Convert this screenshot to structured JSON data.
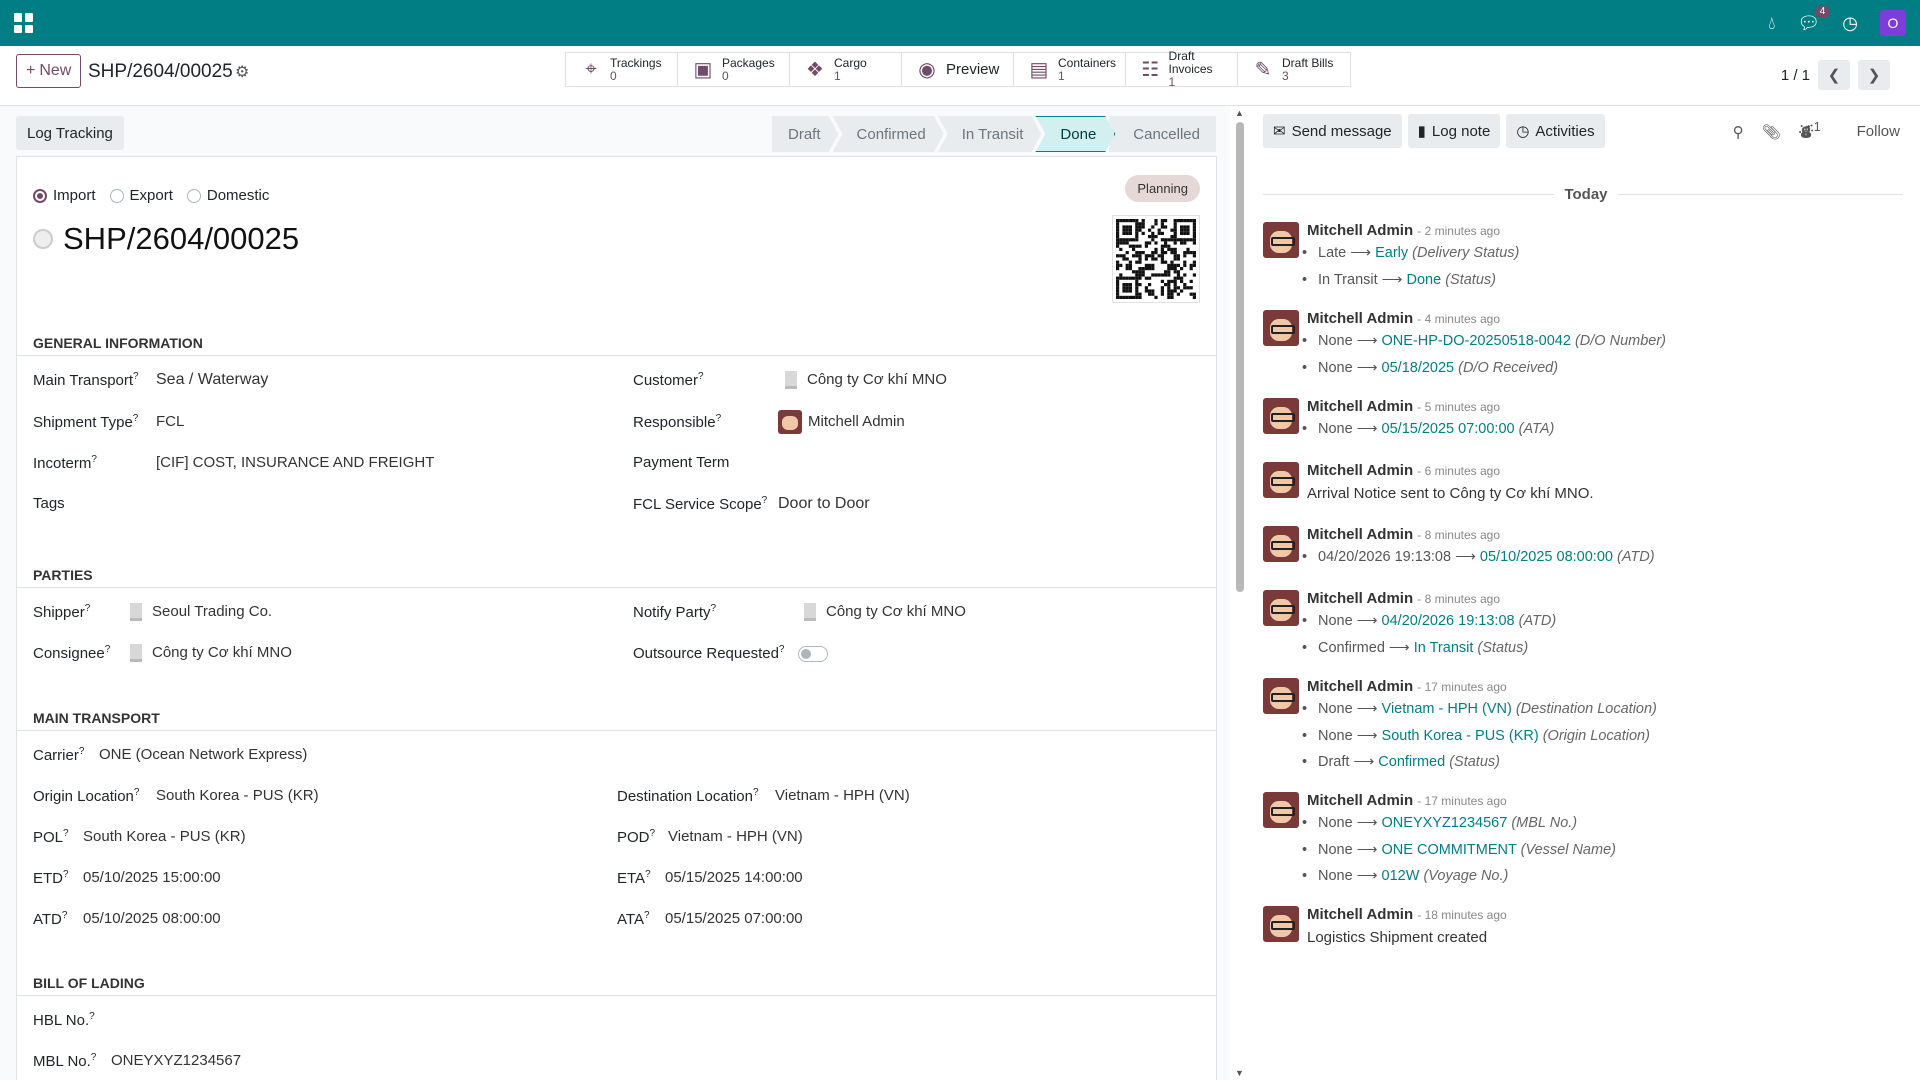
{
  "topbar": {
    "messages_count": "4",
    "user_initial": "O"
  },
  "control": {
    "new_label": "New",
    "record_name": "SHP/2604/00025",
    "pager": "1 / 1"
  },
  "smart_buttons": [
    {
      "label": "Trackings",
      "value": "0",
      "icon": "map-marker-icon"
    },
    {
      "label": "Packages",
      "value": "0",
      "icon": "package-icon"
    },
    {
      "label": "Cargo",
      "value": "1",
      "icon": "cubes-icon"
    },
    {
      "label": "Preview",
      "value": "",
      "icon": "eye-icon"
    },
    {
      "label": "Containers",
      "value": "1",
      "icon": "archive-icon"
    },
    {
      "label": "Draft Invoices",
      "value": "1",
      "icon": "file-text-icon"
    },
    {
      "label": "Draft Bills",
      "value": "3",
      "icon": "edit-icon"
    }
  ],
  "statusbar": {
    "log_button": "Log Tracking",
    "stages": [
      "Draft",
      "Confirmed",
      "In Transit",
      "Done",
      "Cancelled"
    ],
    "active": "Done"
  },
  "form": {
    "radios": [
      "Import",
      "Export",
      "Domestic"
    ],
    "radio_selected": "Import",
    "badge": "Planning",
    "title": "SHP/2604/00025",
    "sections": {
      "general": "GENERAL INFORMATION",
      "parties": "PARTIES",
      "transport": "MAIN TRANSPORT",
      "bol": "BILL OF LADING"
    },
    "general": {
      "main_transport_label": "Main Transport",
      "main_transport": "Sea / Waterway",
      "shipment_type_label": "Shipment Type",
      "shipment_type": "FCL",
      "incoterm_label": "Incoterm",
      "incoterm": "[CIF] COST, INSURANCE AND FREIGHT",
      "tags_label": "Tags",
      "customer_label": "Customer",
      "customer": "Công ty Cơ khí MNO",
      "responsible_label": "Responsible",
      "responsible": "Mitchell Admin",
      "payment_term_label": "Payment Term",
      "fcl_scope_label": "FCL Service Scope",
      "fcl_scope": "Door to Door"
    },
    "parties": {
      "shipper_label": "Shipper",
      "shipper": "Seoul Trading Co.",
      "consignee_label": "Consignee",
      "consignee": "Công ty Cơ khí MNO",
      "notify_label": "Notify Party",
      "notify": "Công ty Cơ khí MNO",
      "outsource_label": "Outsource Requested"
    },
    "transport": {
      "carrier_label": "Carrier",
      "carrier": "ONE (Ocean Network Express)",
      "origin_label": "Origin Location",
      "origin": "South Korea - PUS (KR)",
      "dest_label": "Destination Location",
      "dest": "Vietnam - HPH (VN)",
      "pol_label": "POL",
      "pol": "South Korea - PUS (KR)",
      "pod_label": "POD",
      "pod": "Vietnam - HPH (VN)",
      "etd_label": "ETD",
      "etd": "05/10/2025 15:00:00",
      "eta_label": "ETA",
      "eta": "05/15/2025 14:00:00",
      "atd_label": "ATD",
      "atd": "05/10/2025 08:00:00",
      "ata_label": "ATA",
      "ata": "05/15/2025 07:00:00"
    },
    "bol": {
      "hbl_label": "HBL No.",
      "mbl_label": "MBL No.",
      "mbl": "ONEYXYZ1234567"
    }
  },
  "chatter": {
    "send_message": "Send message",
    "log_note": "Log note",
    "activities": "Activities",
    "followers_count": "1",
    "follow": "Follow",
    "today": "Today",
    "messages": [
      {
        "author": "Mitchell Admin",
        "time": "- 2 minutes ago",
        "lines": [
          {
            "old": "Late",
            "new": "Early",
            "field": "(Delivery Status)"
          },
          {
            "old": "In Transit",
            "new": "Done",
            "field": "(Status)"
          }
        ]
      },
      {
        "author": "Mitchell Admin",
        "time": "- 4 minutes ago",
        "lines": [
          {
            "old": "None",
            "new": "ONE-HP-DO-20250518-0042",
            "field": "(D/O Number)"
          },
          {
            "old": "None",
            "new": "05/18/2025",
            "field": "(D/O Received)"
          }
        ]
      },
      {
        "author": "Mitchell Admin",
        "time": "- 5 minutes ago",
        "lines": [
          {
            "old": "None",
            "new": "05/15/2025 07:00:00",
            "field": "(ATA)"
          }
        ]
      },
      {
        "author": "Mitchell Admin",
        "time": "- 6 minutes ago",
        "body": "Arrival Notice sent to Công ty Cơ khí MNO."
      },
      {
        "author": "Mitchell Admin",
        "time": "- 8 minutes ago",
        "lines": [
          {
            "old": "04/20/2026 19:13:08",
            "new": "05/10/2025 08:00:00",
            "field": "(ATD)"
          }
        ]
      },
      {
        "author": "Mitchell Admin",
        "time": "- 8 minutes ago",
        "lines": [
          {
            "old": "None",
            "new": "04/20/2026 19:13:08",
            "field": "(ATD)"
          },
          {
            "old": "Confirmed",
            "new": "In Transit",
            "field": "(Status)"
          }
        ]
      },
      {
        "author": "Mitchell Admin",
        "time": "- 17 minutes ago",
        "lines": [
          {
            "old": "None",
            "new": "Vietnam - HPH (VN)",
            "field": "(Destination Location)"
          },
          {
            "old": "None",
            "new": "South Korea - PUS (KR)",
            "field": "(Origin Location)"
          },
          {
            "old": "Draft",
            "new": "Confirmed",
            "field": "(Status)"
          }
        ]
      },
      {
        "author": "Mitchell Admin",
        "time": "- 17 minutes ago",
        "lines": [
          {
            "old": "None",
            "new": "ONEYXYZ1234567",
            "field": "(MBL No.)"
          },
          {
            "old": "None",
            "new": "ONE COMMITMENT",
            "field": "(Vessel Name)"
          },
          {
            "old": "None",
            "new": "012W",
            "field": "(Voyage No.)"
          }
        ]
      },
      {
        "author": "Mitchell Admin",
        "time": "- 18 minutes ago",
        "body": "Logistics Shipment created"
      }
    ]
  }
}
